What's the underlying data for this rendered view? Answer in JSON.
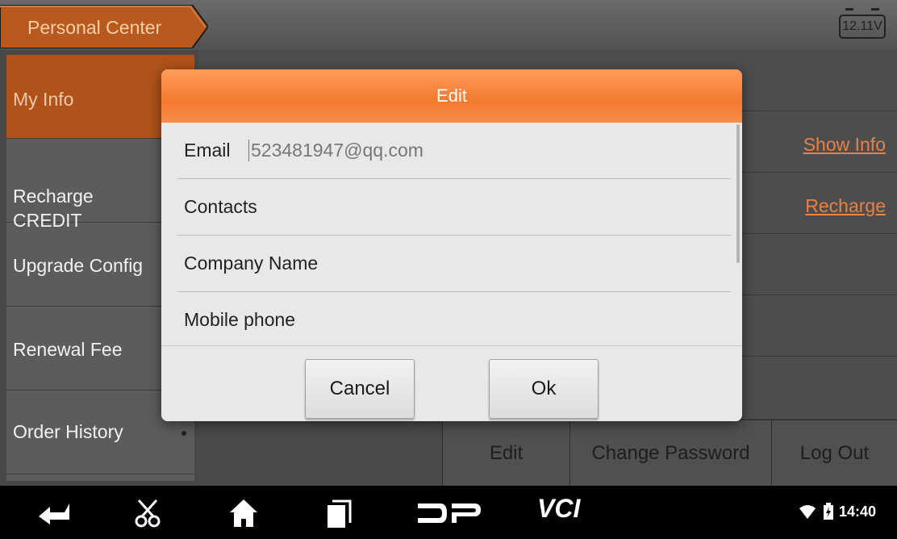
{
  "header": {
    "title": "Personal Center",
    "voltage": "12.11V"
  },
  "sidebar": {
    "items": [
      {
        "label": "My Info"
      },
      {
        "label": "Recharge\nCREDIT"
      },
      {
        "label": "Upgrade Config"
      },
      {
        "label": "Renewal Fee"
      },
      {
        "label": "Order History"
      }
    ]
  },
  "content": {
    "show_info_link": "Show Info",
    "recharge_link": "Recharge"
  },
  "bottom_actions": {
    "edit": "Edit",
    "change_password": "Change Password",
    "log_out": "Log Out"
  },
  "dialog": {
    "title": "Edit",
    "fields": [
      {
        "label": "Email",
        "value": "523481947@qq.com"
      },
      {
        "label": "Contacts",
        "value": ""
      },
      {
        "label": "Company Name",
        "value": ""
      },
      {
        "label": "Mobile phone",
        "value": ""
      }
    ],
    "cancel_label": "Cancel",
    "ok_label": "Ok"
  },
  "navbar": {
    "icons": [
      "back-icon",
      "scissors-icon",
      "home-icon",
      "recent-apps-icon",
      "dp-icon",
      "vci-icon"
    ],
    "vci_text": "VCI",
    "dp_text": "DP",
    "time": "14:40"
  },
  "colors": {
    "accent": "#f47a2d",
    "active_sidebar": "#b0531b",
    "link": "#e98145"
  }
}
